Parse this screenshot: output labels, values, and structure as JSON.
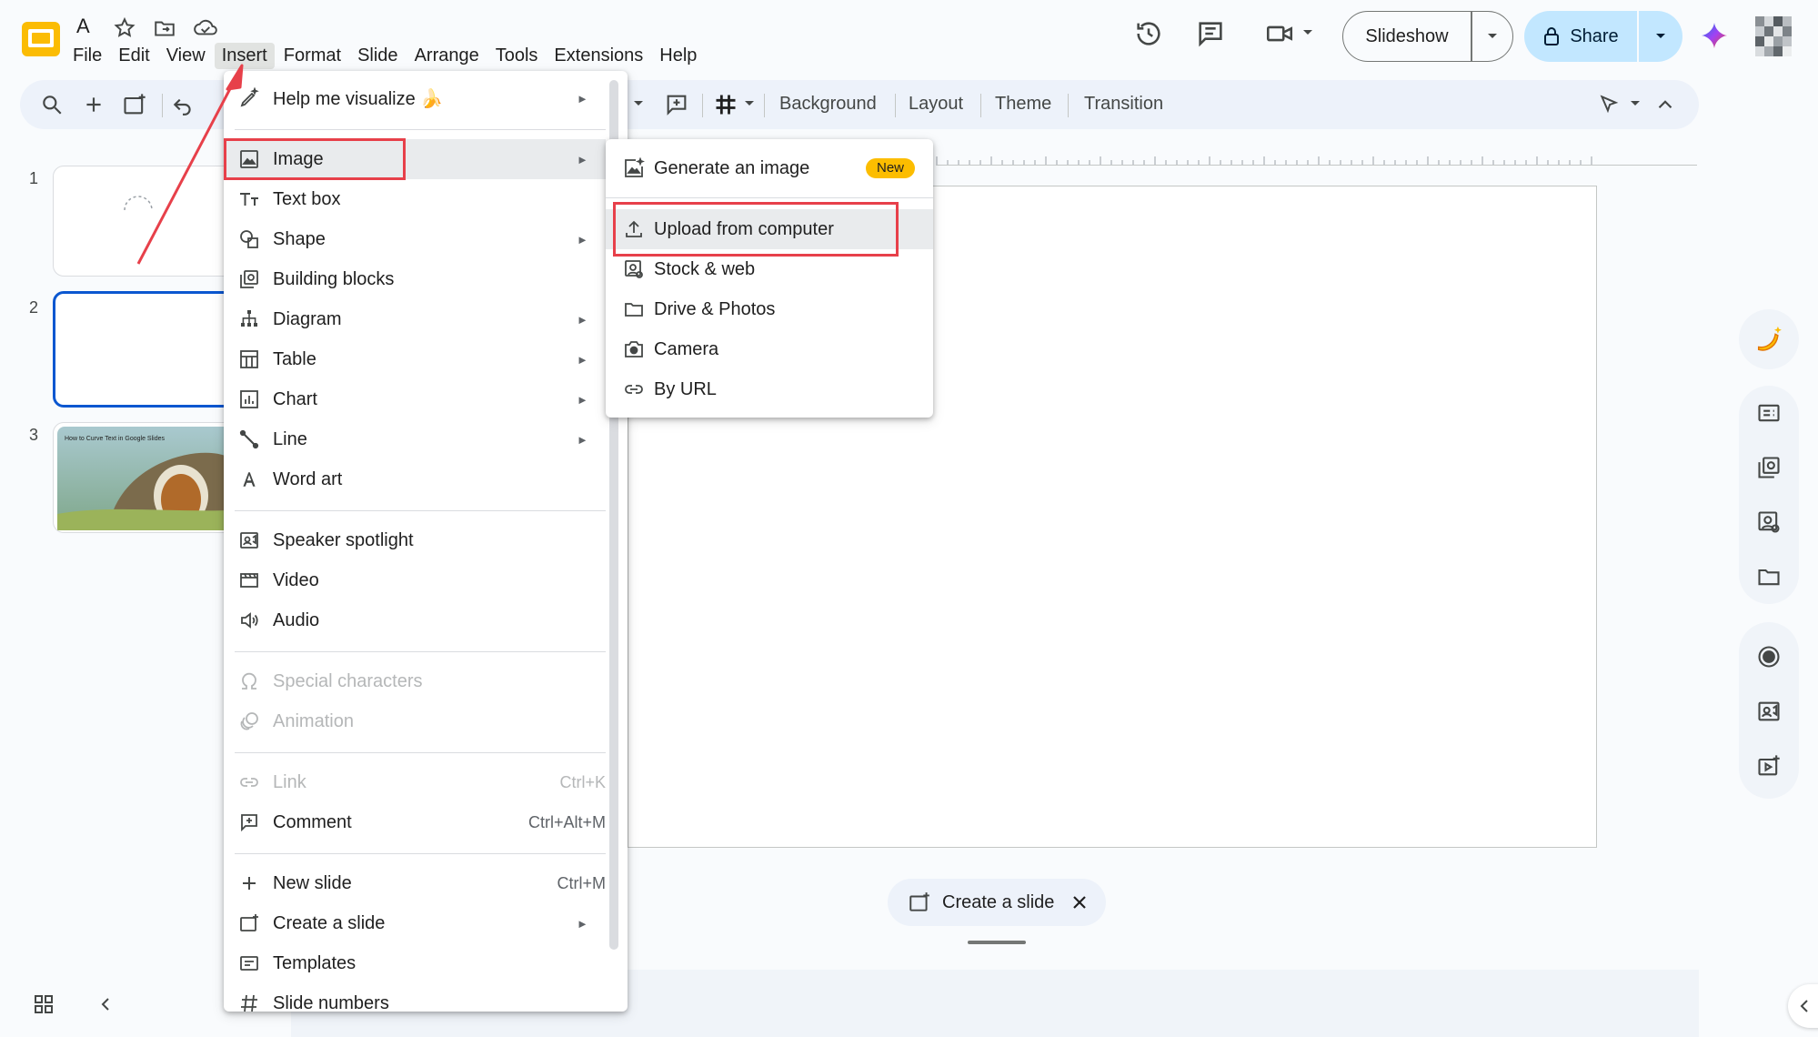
{
  "app": {
    "title": "A",
    "menus": [
      "File",
      "Edit",
      "View",
      "Insert",
      "Format",
      "Slide",
      "Arrange",
      "Tools",
      "Extensions",
      "Help"
    ],
    "active_menu": "Insert",
    "colors": {
      "accent": "#0b57d0",
      "share_bg": "#c2e7ff",
      "annotation": "#e7404a",
      "new_badge": "#fcbd00"
    }
  },
  "header": {
    "slideshow_label": "Slideshow",
    "share_label": "Share"
  },
  "toolbar": {
    "background_label": "Background",
    "layout_label": "Layout",
    "theme_label": "Theme",
    "transition_label": "Transition"
  },
  "filmstrip": {
    "slides": [
      {
        "number": "1"
      },
      {
        "number": "2"
      },
      {
        "number": "3",
        "caption": "How to Curve Text in Google Slides"
      }
    ]
  },
  "canvas": {
    "create_slide_label": "Create a slide"
  },
  "insert_menu": {
    "items": [
      {
        "label": "Help me visualize 🍌",
        "icon": "pen-sparkle-icon",
        "submenu": true
      },
      {
        "label": "Image",
        "icon": "image-icon",
        "submenu": true
      },
      {
        "label": "Text box",
        "icon": "text-box-icon"
      },
      {
        "label": "Shape",
        "icon": "shape-icon",
        "submenu": true
      },
      {
        "label": "Building blocks",
        "icon": "building-blocks-icon"
      },
      {
        "label": "Diagram",
        "icon": "diagram-icon",
        "submenu": true
      },
      {
        "label": "Table",
        "icon": "table-icon",
        "submenu": true
      },
      {
        "label": "Chart",
        "icon": "chart-icon",
        "submenu": true
      },
      {
        "label": "Line",
        "icon": "line-icon",
        "submenu": true
      },
      {
        "label": "Word art",
        "icon": "word-art-icon"
      },
      {
        "label": "Speaker spotlight",
        "icon": "speaker-spotlight-icon"
      },
      {
        "label": "Video",
        "icon": "video-icon"
      },
      {
        "label": "Audio",
        "icon": "audio-icon"
      },
      {
        "label": "Special characters",
        "icon": "omega-icon",
        "disabled": true
      },
      {
        "label": "Animation",
        "icon": "animation-icon",
        "disabled": true
      },
      {
        "label": "Link",
        "icon": "link-icon",
        "shortcut": "Ctrl+K",
        "disabled": true
      },
      {
        "label": "Comment",
        "icon": "comment-icon",
        "shortcut": "Ctrl+Alt+M"
      },
      {
        "label": "New slide",
        "icon": "plus-icon",
        "shortcut": "Ctrl+M"
      },
      {
        "label": "Create a slide",
        "icon": "create-slide-icon",
        "submenu": true
      },
      {
        "label": "Templates",
        "icon": "templates-icon"
      },
      {
        "label": "Slide numbers",
        "icon": "hash-icon"
      }
    ]
  },
  "image_submenu": {
    "items": [
      {
        "label": "Generate an image",
        "icon": "generate-image-icon",
        "badge": "New"
      },
      {
        "label": "Upload from computer",
        "icon": "upload-icon"
      },
      {
        "label": "Stock & web",
        "icon": "stock-web-icon"
      },
      {
        "label": "Drive & Photos",
        "icon": "folder-icon"
      },
      {
        "label": "Camera",
        "icon": "camera-icon"
      },
      {
        "label": "By URL",
        "icon": "link-icon"
      }
    ]
  }
}
